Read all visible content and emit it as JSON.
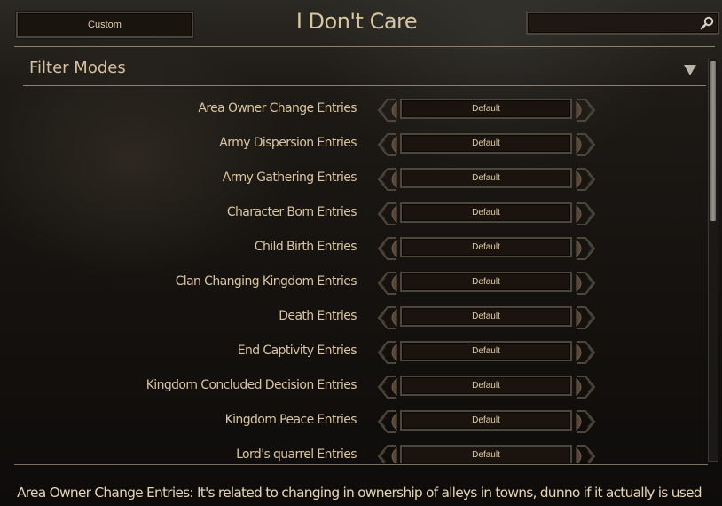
{
  "header": {
    "preset_button": "Custom",
    "title": "I Don't Care",
    "search": {
      "value": "",
      "placeholder": ""
    }
  },
  "section": {
    "title": "Filter Modes",
    "collapsed": false
  },
  "rows": [
    {
      "label": "Area Owner Change Entries",
      "value": "Default"
    },
    {
      "label": "Army Dispersion Entries",
      "value": "Default"
    },
    {
      "label": "Army Gathering Entries",
      "value": "Default"
    },
    {
      "label": "Character Born Entries",
      "value": "Default"
    },
    {
      "label": "Child Birth Entries",
      "value": "Default"
    },
    {
      "label": "Clan Changing Kingdom Entries",
      "value": "Default"
    },
    {
      "label": "Death Entries",
      "value": "Default"
    },
    {
      "label": "End Captivity Entries",
      "value": "Default"
    },
    {
      "label": "Kingdom Concluded Decision Entries",
      "value": "Default"
    },
    {
      "label": "Kingdom Peace Entries",
      "value": "Default"
    },
    {
      "label": "Lord's quarrel Entries",
      "value": "Default"
    }
  ],
  "description": "Area Owner Change Entries: It's related to changing in ownership of alleys in towns, dunno if it actually is used",
  "colors": {
    "text": "#d9c4a0",
    "accent_line": "#8d8068",
    "background": "#15120f"
  }
}
